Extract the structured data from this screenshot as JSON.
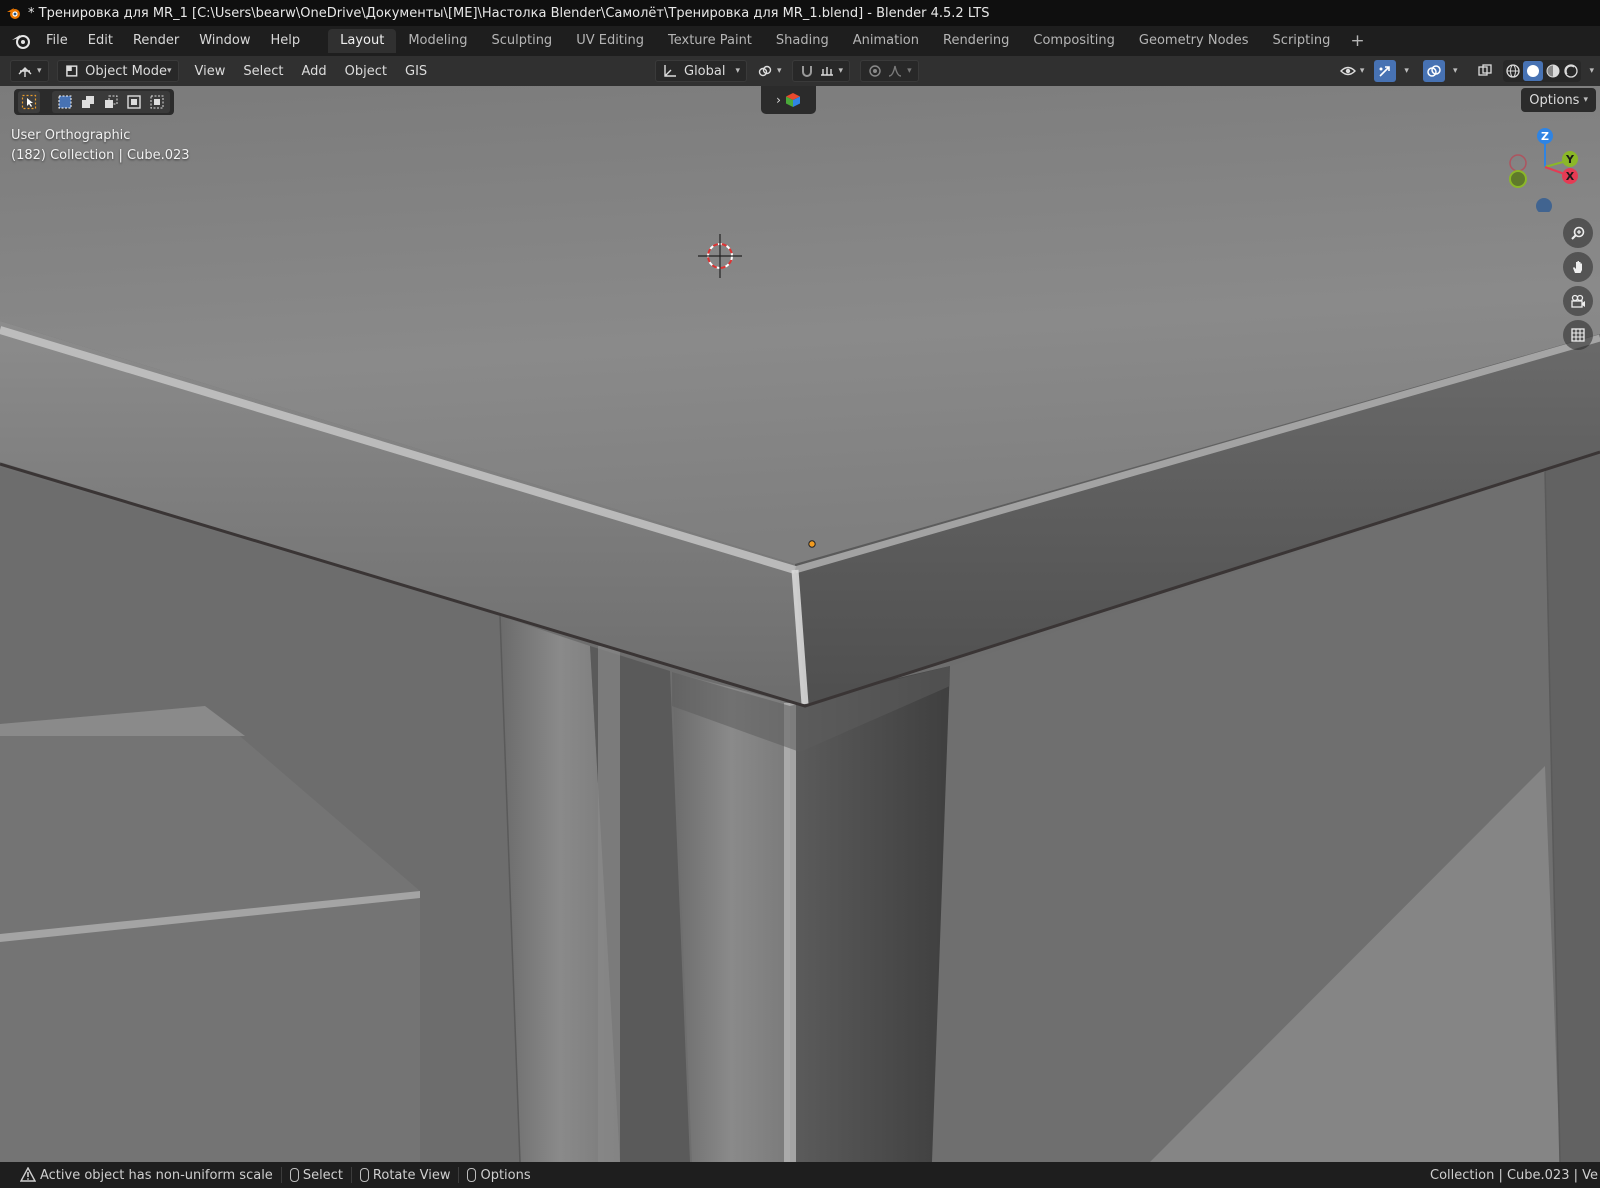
{
  "window": {
    "title": "* Тренировка для MR_1 [C:\\Users\\bearw\\OneDrive\\Документы\\[ME]\\Настолка Blender\\Самолёт\\Тренировка для MR_1.blend] - Blender 4.5.2 LTS"
  },
  "menu": {
    "items": [
      "File",
      "Edit",
      "Render",
      "Window",
      "Help"
    ]
  },
  "workspaces": {
    "tabs": [
      "Layout",
      "Modeling",
      "Sculpting",
      "UV Editing",
      "Texture Paint",
      "Shading",
      "Animation",
      "Rendering",
      "Compositing",
      "Geometry Nodes",
      "Scripting"
    ],
    "active": "Layout",
    "add_label": "+"
  },
  "header": {
    "mode": "Object Mode",
    "menus": [
      "View",
      "Select",
      "Add",
      "Object",
      "GIS"
    ],
    "transform_orientation": "Global"
  },
  "viewport": {
    "view_name": "User Orthographic",
    "object_info": "(182) Collection | Cube.023",
    "options_label": "Options",
    "axes": {
      "z": "Z",
      "y": "Y",
      "x": "X"
    }
  },
  "statusbar": {
    "warning": "Active object has non-uniform scale",
    "hints": [
      "Select",
      "Rotate View",
      "Options"
    ],
    "right_info": "Collection | Cube.023 | Ve"
  },
  "colors": {
    "accent_blue": "#4772b3",
    "axis_x": "#e53b54",
    "axis_y": "#8bb728",
    "axis_z": "#2f84e3",
    "origin": "#f19a1f"
  }
}
